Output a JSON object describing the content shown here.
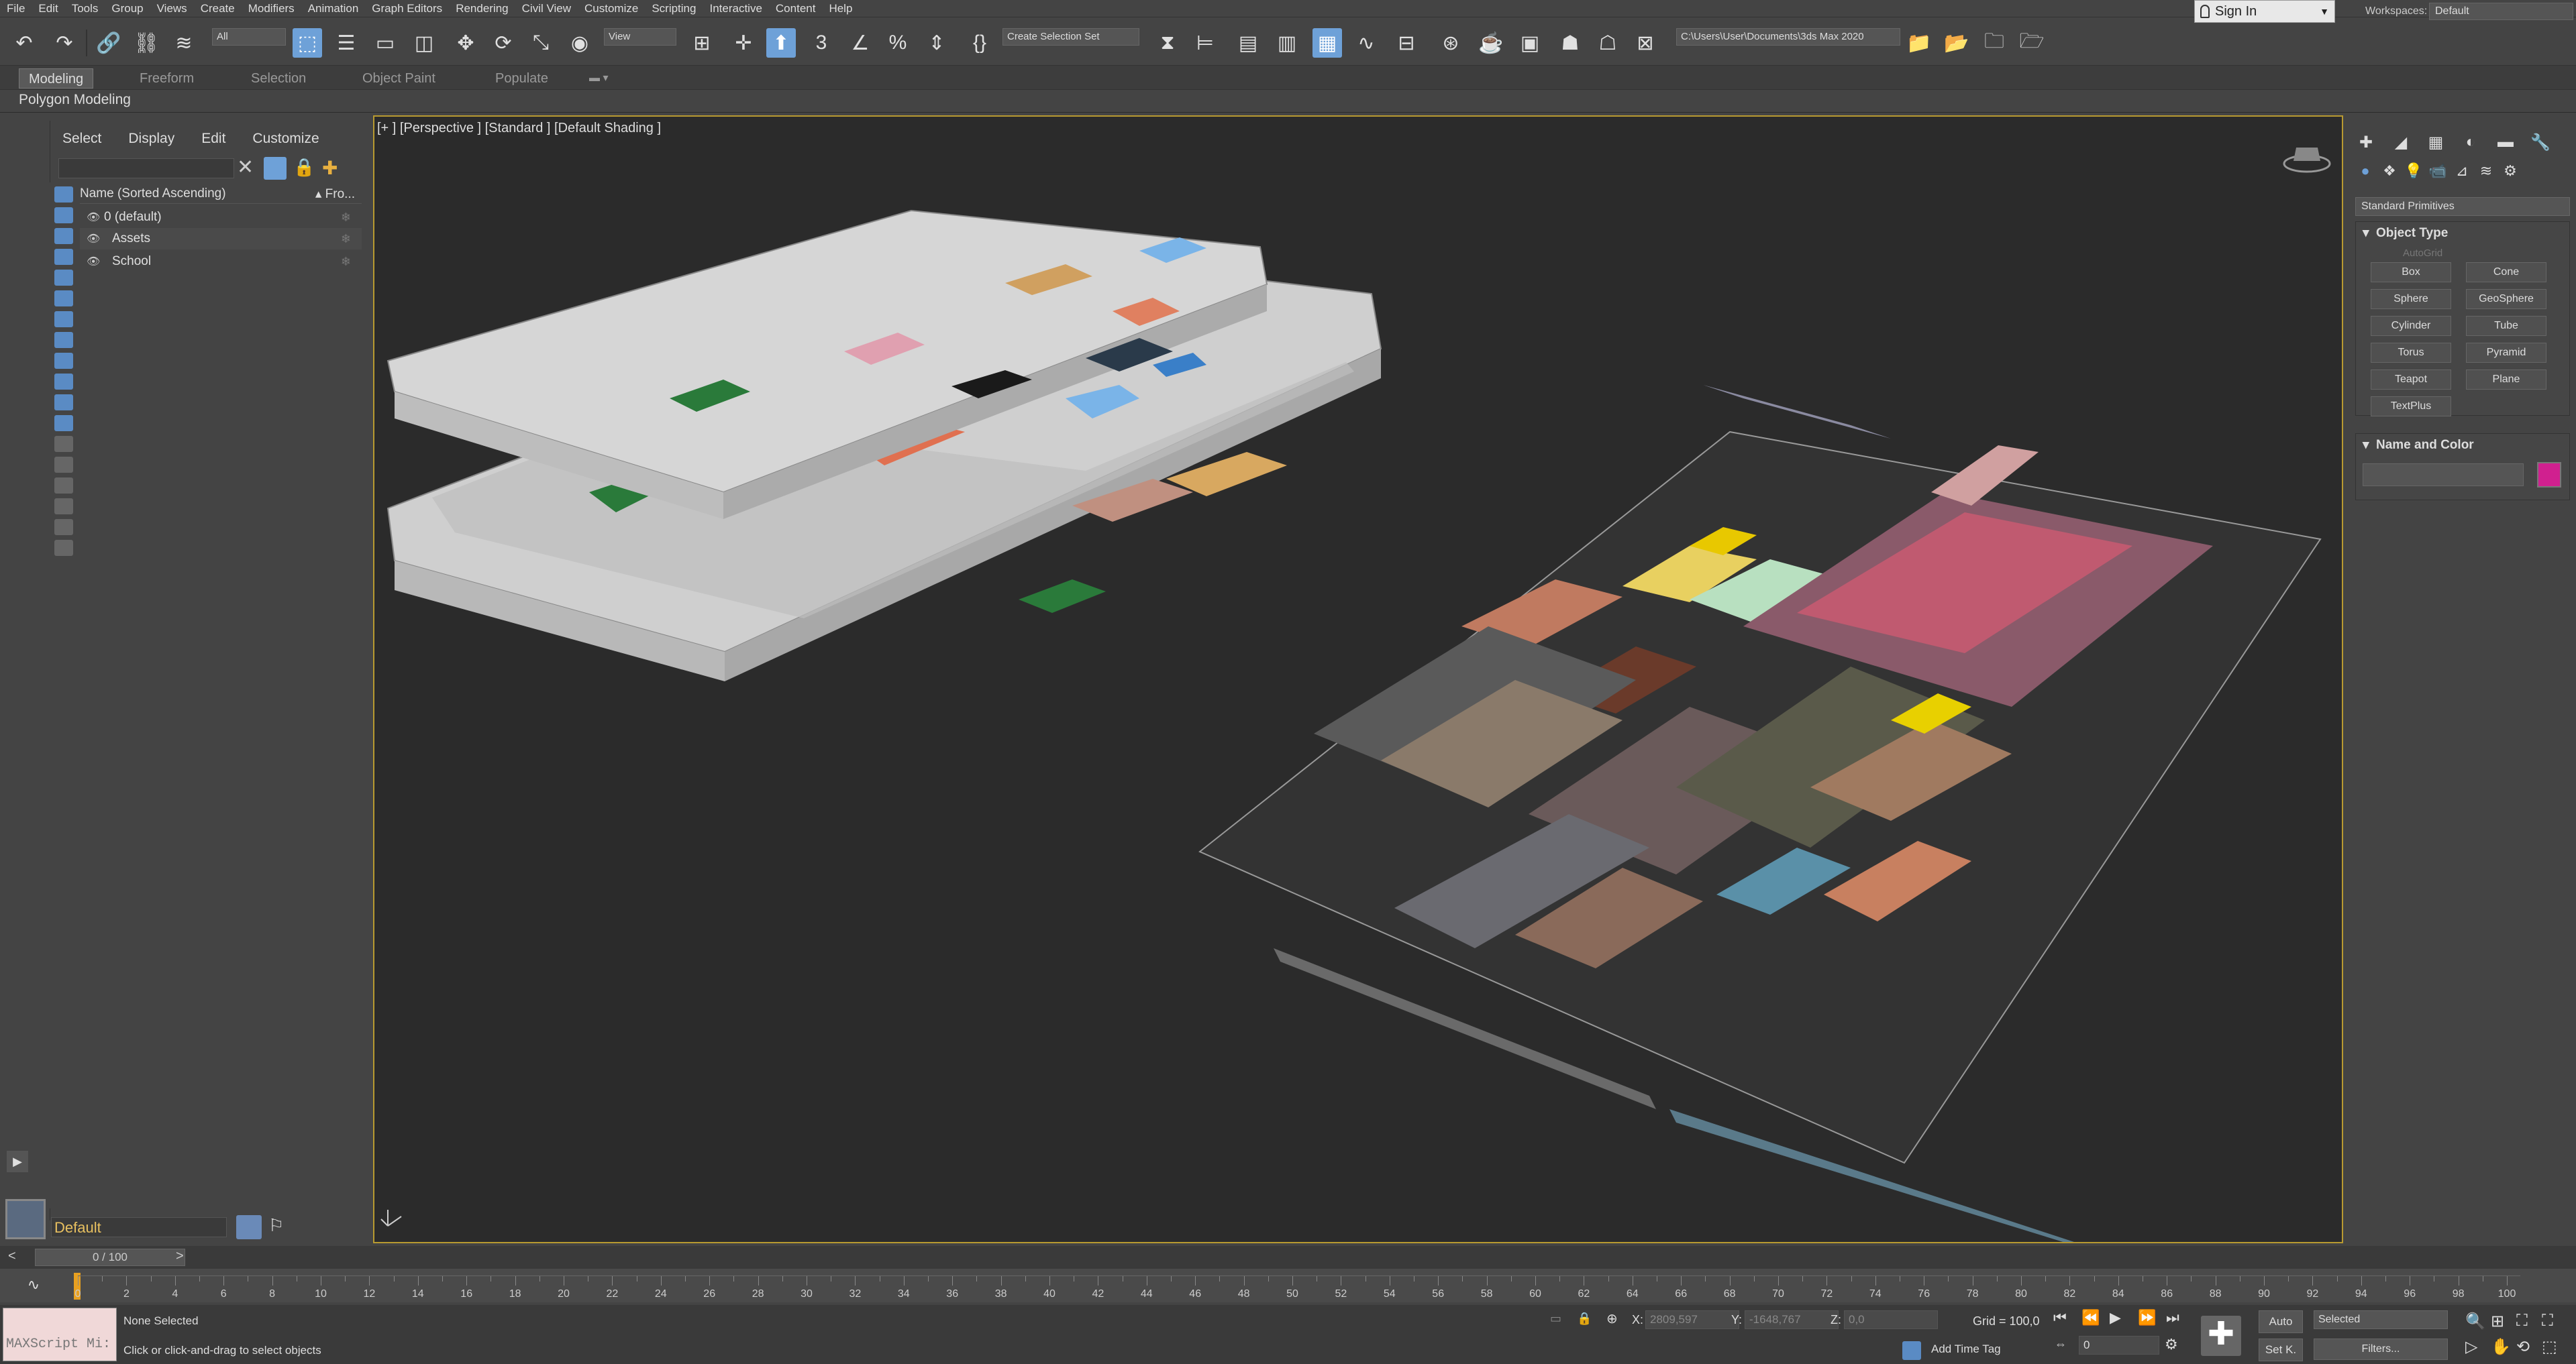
{
  "menu": [
    "File",
    "Edit",
    "Tools",
    "Group",
    "Views",
    "Create",
    "Modifiers",
    "Animation",
    "Graph Editors",
    "Rendering",
    "Civil View",
    "Customize",
    "Scripting",
    "Interactive",
    "Content",
    "Help"
  ],
  "signin": "Sign In",
  "workspace": {
    "label": "Workspaces:",
    "value": "Default"
  },
  "toolbar": {
    "filter": "All",
    "refcoord": "View",
    "selset": "Create Selection Set",
    "path": "C:\\Users\\User\\Documents\\3ds Max 2020"
  },
  "ribbon": {
    "tabs": [
      "Modeling",
      "Freeform",
      "Selection",
      "Object Paint",
      "Populate"
    ],
    "panel": "Polygon Modeling"
  },
  "explorer": {
    "menu": [
      "Select",
      "Display",
      "Edit",
      "Customize"
    ],
    "header": "Name (Sorted Ascending)",
    "header_right": "▴ Fro...",
    "rows": [
      "0 (default)",
      "Assets",
      "School"
    ]
  },
  "layer": {
    "name": "Default"
  },
  "viewport": {
    "label": "[+ ]  [Perspective ]  [Standard ]  [Default Shading ]"
  },
  "command_panel": {
    "category": "Standard Primitives",
    "object_type": "Object Type",
    "autogrid": "AutoGrid",
    "buttons": [
      "Box",
      "Cone",
      "Sphere",
      "GeoSphere",
      "Cylinder",
      "Tube",
      "Torus",
      "Pyramid",
      "Teapot",
      "Plane",
      "TextPlus"
    ],
    "name_color": "Name and Color",
    "object_color": "#d0208f"
  },
  "time": {
    "slider": "0 / 100",
    "ticks": [
      "0",
      "2",
      "4",
      "6",
      "8",
      "10",
      "12",
      "14",
      "16",
      "18",
      "20",
      "22",
      "24",
      "26",
      "28",
      "30",
      "32",
      "34",
      "36",
      "38",
      "40",
      "42",
      "44",
      "46",
      "48",
      "50",
      "52",
      "54",
      "56",
      "58",
      "60",
      "62",
      "64",
      "66",
      "68",
      "70",
      "72",
      "74",
      "76",
      "78",
      "80",
      "82",
      "84",
      "86",
      "88",
      "90",
      "92",
      "94",
      "96",
      "98",
      "100"
    ]
  },
  "status": {
    "maxscript": "MAXScript Mi:",
    "line1": "None Selected",
    "line2": "Click or click-and-drag to select objects",
    "x_label": "X:",
    "x_val": "2809,597",
    "y_label": "Y:",
    "y_val": "-1648,767",
    "z_label": "Z:",
    "z_val": "0,0",
    "grid": "Grid = 100,0",
    "addtag": "Add Time Tag",
    "frame": "0",
    "auto": "Auto",
    "setk": "Set K.",
    "selected": "Selected",
    "filters": "Filters..."
  },
  "colors": {
    "accent": "#6ea1d8",
    "viewport_border": "#b89a30",
    "layer_name": "#e8c060"
  }
}
